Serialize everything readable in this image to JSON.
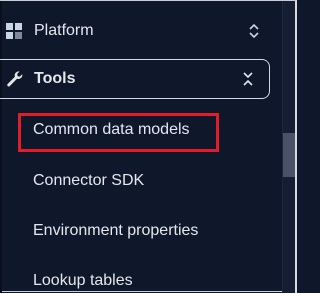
{
  "sidebar": {
    "platform": {
      "label": "Platform",
      "icon": "grid-icon",
      "chevron": "expand-collapse-icon"
    },
    "tools": {
      "label": "Tools",
      "icon": "wrench-icon",
      "chevron": "collapse-icon",
      "expanded": true,
      "items": [
        {
          "label": "Common data models"
        },
        {
          "label": "Connector SDK"
        },
        {
          "label": "Environment properties"
        },
        {
          "label": "Lookup tables"
        }
      ]
    }
  },
  "colors": {
    "background": "#0f172a",
    "text": "#e5e7eb",
    "highlight": "#e11d2a"
  }
}
